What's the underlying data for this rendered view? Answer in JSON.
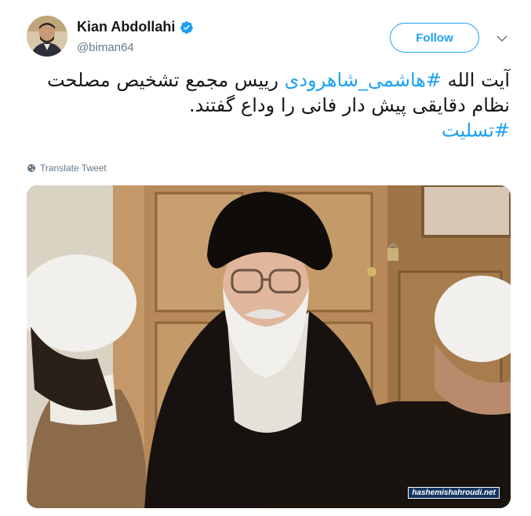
{
  "author": {
    "display_name": "Kian Abdollahi",
    "handle": "@biman64",
    "verified": true
  },
  "follow_label": "Follow",
  "tweet": {
    "line1": {
      "prefix": "آیت الله ",
      "hashtag": "#هاشمی_شاهرودی",
      "suffix": " رییس مجمع تشخیص مصلحت"
    },
    "line2": "نظام دقایقی پیش دار فانی را وداع گفتند.",
    "line3_hashtag": "#تسلیت"
  },
  "translate_label": "Translate Tweet",
  "photo": {
    "watermark": "hashemishahroudi.net"
  },
  "colors": {
    "accent": "#1da1f2",
    "text": "#14171a",
    "secondary": "#657786"
  },
  "icons": [
    "verified-badge-icon",
    "chevron-down-icon",
    "globe-icon"
  ]
}
